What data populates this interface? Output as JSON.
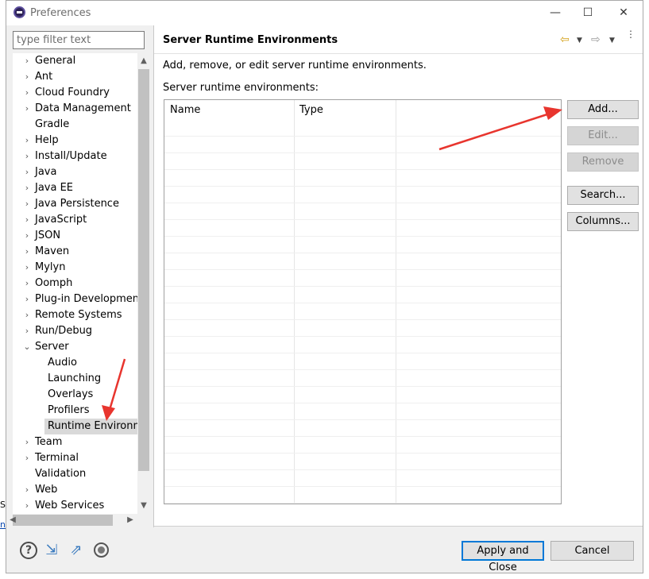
{
  "window": {
    "title": "Preferences",
    "minimize": "—",
    "maximize": "☐",
    "close": "✕"
  },
  "filter": {
    "placeholder": "type filter text"
  },
  "tree": {
    "items": [
      {
        "label": "General",
        "expandable": true,
        "depth": 0
      },
      {
        "label": "Ant",
        "expandable": true,
        "depth": 0
      },
      {
        "label": "Cloud Foundry",
        "expandable": true,
        "depth": 0
      },
      {
        "label": "Data Management",
        "expandable": true,
        "depth": 0
      },
      {
        "label": "Gradle",
        "expandable": false,
        "depth": 0
      },
      {
        "label": "Help",
        "expandable": true,
        "depth": 0
      },
      {
        "label": "Install/Update",
        "expandable": true,
        "depth": 0
      },
      {
        "label": "Java",
        "expandable": true,
        "depth": 0
      },
      {
        "label": "Java EE",
        "expandable": true,
        "depth": 0
      },
      {
        "label": "Java Persistence",
        "expandable": true,
        "depth": 0
      },
      {
        "label": "JavaScript",
        "expandable": true,
        "depth": 0
      },
      {
        "label": "JSON",
        "expandable": true,
        "depth": 0
      },
      {
        "label": "Maven",
        "expandable": true,
        "depth": 0
      },
      {
        "label": "Mylyn",
        "expandable": true,
        "depth": 0
      },
      {
        "label": "Oomph",
        "expandable": true,
        "depth": 0
      },
      {
        "label": "Plug-in Development",
        "expandable": true,
        "depth": 0
      },
      {
        "label": "Remote Systems",
        "expandable": true,
        "depth": 0
      },
      {
        "label": "Run/Debug",
        "expandable": true,
        "depth": 0
      },
      {
        "label": "Server",
        "expandable": true,
        "expanded": true,
        "depth": 0
      },
      {
        "label": "Audio",
        "expandable": false,
        "depth": 1
      },
      {
        "label": "Launching",
        "expandable": false,
        "depth": 1
      },
      {
        "label": "Overlays",
        "expandable": false,
        "depth": 1
      },
      {
        "label": "Profilers",
        "expandable": false,
        "depth": 1
      },
      {
        "label": "Runtime Environme",
        "expandable": false,
        "depth": 1,
        "selected": true
      },
      {
        "label": "Team",
        "expandable": true,
        "depth": 0
      },
      {
        "label": "Terminal",
        "expandable": true,
        "depth": 0
      },
      {
        "label": "Validation",
        "expandable": false,
        "depth": 0
      },
      {
        "label": "Web",
        "expandable": true,
        "depth": 0
      },
      {
        "label": "Web Services",
        "expandable": true,
        "depth": 0
      }
    ]
  },
  "page": {
    "title": "Server Runtime Environments",
    "description": "Add, remove, or edit server runtime environments.",
    "list_label": "Server runtime environments:"
  },
  "table": {
    "columns": [
      "Name",
      "Type"
    ],
    "rows": []
  },
  "buttons": {
    "add": "Add...",
    "edit": "Edit...",
    "remove": "Remove",
    "search": "Search...",
    "columns": "Columns...",
    "apply_close": "Apply and Close",
    "cancel": "Cancel"
  },
  "icons": {
    "back": "arrow-left-icon",
    "forward": "arrow-right-icon",
    "menu": "view-menu-icon",
    "help": "help-icon",
    "import": "import-icon",
    "export": "export-icon",
    "record": "record-icon"
  },
  "colors": {
    "annotation_arrow": "#e8352e",
    "default_button_border": "#0078d7",
    "selection": "#d9d9d9"
  },
  "edge_text": {
    "line1": "Se",
    "line2": "ni"
  }
}
